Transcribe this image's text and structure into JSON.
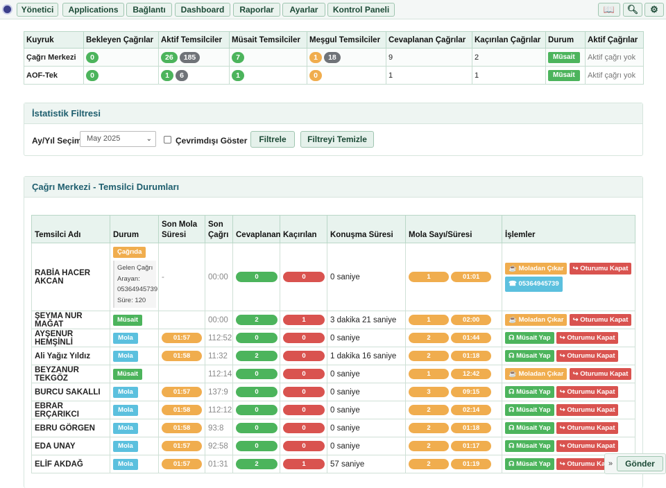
{
  "nav": {
    "items": [
      "Yönetici",
      "Applications",
      "Bağlantı",
      "Dashboard",
      "Raporlar",
      "Ayarlar",
      "Kontrol Paneli"
    ],
    "icons": [
      "translate-icon",
      "search-icon",
      "gear-icon"
    ]
  },
  "queues": {
    "headers": [
      "Kuyruk",
      "Bekleyen Çağrılar",
      "Aktif Temsilciler",
      "Müsait Temsilciler",
      "Meşgul Temsilciler",
      "Cevaplanan Çağrılar",
      "Kaçırılan Çağrılar",
      "Durum",
      "Aktif Çağrılar"
    ],
    "rows": [
      {
        "name": "Çağrı Merkezi",
        "waiting": "0",
        "active_a": "26",
        "active_b": "185",
        "available": "7",
        "busy_a": "1",
        "busy_b": "18",
        "answered": "9",
        "missed": "2",
        "status": "Müsait",
        "active_calls": "Aktif çağrı yok"
      },
      {
        "name": "AOF-Tek",
        "waiting": "0",
        "active_a": "1",
        "active_b": "6",
        "available": "1",
        "busy_a": "0",
        "busy_b": "",
        "answered": "1",
        "missed": "1",
        "status": "Müsait",
        "active_calls": "Aktif çağrı yok"
      }
    ]
  },
  "filter": {
    "title": "İstatistik Filtresi",
    "period_label": "Ay/Yıl Seçimi:",
    "period_value": "May 2025",
    "offline_label": "Çevrimdışı Göster",
    "apply_label": "Filtrele",
    "clear_label": "Filtreyi Temizle"
  },
  "agents": {
    "title": "Çağrı Merkezi - Temsilci Durumları",
    "headers": [
      "Temsilci Adı",
      "Durum",
      "Son Mola Süresi",
      "Son Çağrı",
      "Cevaplanan",
      "Kaçırılan",
      "Konuşma Süresi",
      "Mola Sayı/Süresi",
      "İşlemler"
    ],
    "call_info": {
      "status": "Çağrıda",
      "line1": "Gelen Çağrı",
      "line2": "Arayan:",
      "line3": "05364945739",
      "line4": "Süre: 120"
    },
    "actions": {
      "break_out": "Moladan Çıkar",
      "logout": "Oturumu Kapat",
      "set_available": "Müsait Yap",
      "phone": "05364945739"
    },
    "rows": [
      {
        "name": "RABİA HACER AKCAN",
        "status": "Çağrıda",
        "last_break": "-",
        "last_call": "00:00",
        "answered": "0",
        "missed": "0",
        "talk": "0 saniye",
        "breaks": "1",
        "break_time": "01:01"
      },
      {
        "name": "ŞEYMA NUR MAĞAT",
        "status": "Müsait",
        "last_break": "",
        "last_call": "00:00",
        "answered": "2",
        "missed": "1",
        "talk": "3 dakika 21 saniye",
        "breaks": "1",
        "break_time": "02:00"
      },
      {
        "name": "AYŞENUR HEMŞİNLİ",
        "status": "Mola",
        "last_break": "01:57",
        "last_call": "112:52",
        "answered": "0",
        "missed": "0",
        "talk": "0 saniye",
        "breaks": "2",
        "break_time": "01:44"
      },
      {
        "name": "Ali Yağız Yıldız",
        "status": "Mola",
        "last_break": "01:58",
        "last_call": "11:32",
        "answered": "2",
        "missed": "0",
        "talk": "1 dakika 16 saniye",
        "breaks": "2",
        "break_time": "01:18"
      },
      {
        "name": "BEYZANUR TEKGÖZ",
        "status": "Müsait",
        "last_break": "",
        "last_call": "112:14",
        "answered": "0",
        "missed": "0",
        "talk": "0 saniye",
        "breaks": "1",
        "break_time": "12:42"
      },
      {
        "name": "BURCU SAKALLI",
        "status": "Mola",
        "last_break": "01:57",
        "last_call": "137:9",
        "answered": "0",
        "missed": "0",
        "talk": "0 saniye",
        "breaks": "3",
        "break_time": "09:15"
      },
      {
        "name": "EBRAR ERÇARIKCI",
        "status": "Mola",
        "last_break": "01:58",
        "last_call": "112:12",
        "answered": "0",
        "missed": "0",
        "talk": "0 saniye",
        "breaks": "2",
        "break_time": "02:14"
      },
      {
        "name": "EBRU GÖRGEN",
        "status": "Mola",
        "last_break": "01:58",
        "last_call": "93:8",
        "answered": "0",
        "missed": "0",
        "talk": "0 saniye",
        "breaks": "2",
        "break_time": "01:18"
      },
      {
        "name": "EDA UNAY",
        "status": "Mola",
        "last_break": "01:57",
        "last_call": "92:58",
        "answered": "0",
        "missed": "0",
        "talk": "0 saniye",
        "breaks": "2",
        "break_time": "01:17"
      },
      {
        "name": "ELİF AKDAĞ",
        "status": "Mola",
        "last_break": "01:57",
        "last_call": "01:31",
        "answered": "2",
        "missed": "1",
        "talk": "57 saniye",
        "breaks": "2",
        "break_time": "01:19"
      }
    ]
  },
  "send_label": "Gönder",
  "colors": {
    "accent": "#1e5e6e",
    "green": "#4cb45c",
    "red": "#d9534f",
    "orange": "#f0ad4e",
    "blue": "#5bc0de"
  }
}
